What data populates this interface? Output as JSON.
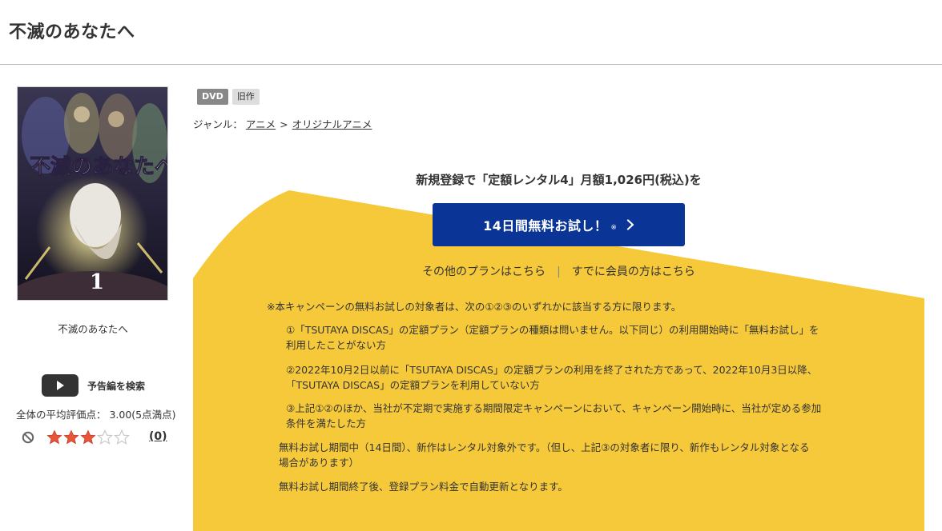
{
  "page": {
    "title": "不滅のあなたへ"
  },
  "sidebar": {
    "cover_alt": "不滅のあなたへ",
    "cover_caption": "不滅のあなたへ",
    "trailer_label": "予告編を検索",
    "rating_label": "全体の平均評価点： 3.00(5点満点)",
    "rating_value": 3,
    "rating_max": 5,
    "review_count": "(0)"
  },
  "badges": [
    "DVD",
    "旧作"
  ],
  "genre": {
    "prefix": "ジャンル：",
    "path": [
      "アニメ",
      "オリジナルアニメ"
    ],
    "separator": ">"
  },
  "promo": {
    "heading": "新規登録で「定額レンタル4」月額1,026円(税込)を",
    "cta_label": "14日間無料お試し！",
    "cta_note": "※",
    "link_other_plans": "その他のプランはこちら",
    "link_separator": "|",
    "link_members": "すでに会員の方はこちら"
  },
  "notices": {
    "intro": "※本キャンペーンの無料お試しの対象者は、次の①②③のいずれかに該当する方に限ります。",
    "item1_line1": "①「TSUTAYA DISCAS」の定額プラン（定額プランの種類は問いません。以下同じ）の利用開始時に「無料お試し」を",
    "item1_line2": "利用したことがない方",
    "item2_line1": "②2022年10月2日以前に「TSUTAYA DISCAS」の定額プランの利用を終了された方であって、2022年10月3日以降、",
    "item2_line2": "「TSUTAYA DISCAS」の定額プランを利用していない方",
    "item3_line1": "③上記①②のほか、当社が不定期で実施する期間限定キャンペーンにおいて、キャンペーン開始時に、当社が定める参加",
    "item3_line2": "条件を満たした方",
    "trial_line1": "無料お試し期間中（14日間）、新作はレンタル対象外です。（但し、上記③の対象者に限り、新作もレンタル対象となる",
    "trial_line2": "場合があります）",
    "renewal": "無料お試し期間終了後、登録プラン料金で自動更新となります。"
  },
  "colors": {
    "brand_blue": "#0a3596",
    "promo_yellow": "#f6c93a",
    "star_fill": "#e8553a",
    "star_empty": "#c8c8c8"
  }
}
